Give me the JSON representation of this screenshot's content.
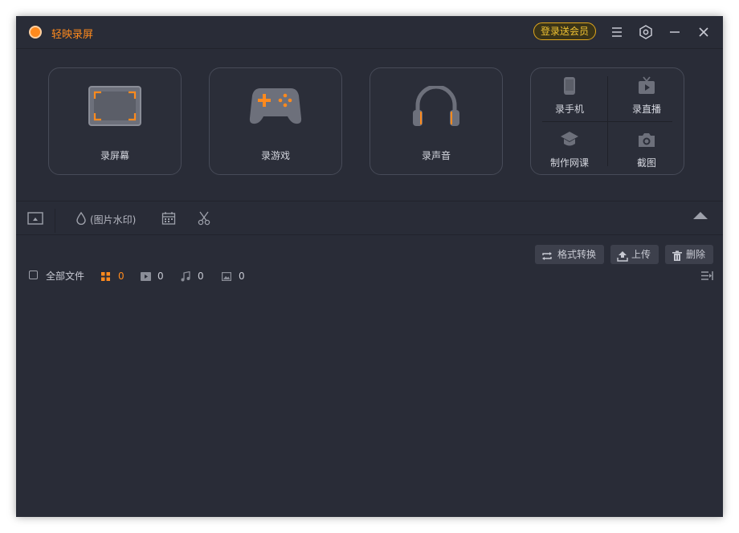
{
  "app": {
    "title": "轻映录屏",
    "vip_label": "登录送会员"
  },
  "modes": [
    {
      "label": "录屏幕",
      "icon": "screen-record-icon"
    },
    {
      "label": "录游戏",
      "icon": "gamepad-icon"
    },
    {
      "label": "录声音",
      "icon": "headphones-icon"
    }
  ],
  "extra_modes": [
    {
      "label": "录手机",
      "icon": "phone-icon"
    },
    {
      "label": "录直播",
      "icon": "tv-live-icon"
    },
    {
      "label": "制作网课",
      "icon": "graduation-cap-icon"
    },
    {
      "label": "截图",
      "icon": "camera-icon"
    }
  ],
  "toolbar": {
    "watermark_label": "(图片水印)"
  },
  "actions": {
    "convert_label": "格式转换",
    "upload_label": "上传",
    "delete_label": "删除"
  },
  "filters": {
    "all_label": "全部文件",
    "all_count": "0",
    "video_count": "0",
    "audio_count": "0",
    "image_count": "0"
  },
  "colors": {
    "accent": "#ff8a1d",
    "background": "#292c37",
    "card_border": "#474b58",
    "vip": "#f0c232"
  }
}
